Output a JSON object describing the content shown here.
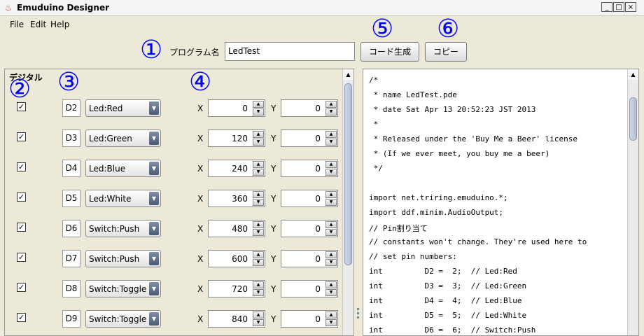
{
  "window": {
    "title": "Emuduino Designer"
  },
  "menu": [
    "File",
    "Edit",
    "Help"
  ],
  "callouts": [
    "①",
    "②",
    "③",
    "④",
    "⑤",
    "⑥"
  ],
  "toolbar": {
    "program_label": "プログラム名",
    "program_value": "LedTest",
    "generate_label": "コード生成",
    "copy_label": "コピー"
  },
  "digital": {
    "title": "デジタル",
    "rows": [
      {
        "pin": "D2",
        "type": "Led:Red",
        "x": "0",
        "y": "0"
      },
      {
        "pin": "D3",
        "type": "Led:Green",
        "x": "120",
        "y": "0"
      },
      {
        "pin": "D4",
        "type": "Led:Blue",
        "x": "240",
        "y": "0"
      },
      {
        "pin": "D5",
        "type": "Led:White",
        "x": "360",
        "y": "0"
      },
      {
        "pin": "D6",
        "type": "Switch:Push",
        "x": "480",
        "y": "0"
      },
      {
        "pin": "D7",
        "type": "Switch:Push",
        "x": "600",
        "y": "0"
      },
      {
        "pin": "D8",
        "type": "Switch:Toggle",
        "x": "720",
        "y": "0"
      },
      {
        "pin": "D9",
        "type": "Switch:Toggle",
        "x": "840",
        "y": "0"
      }
    ],
    "x_label": "X",
    "y_label": "Y"
  },
  "code_lines": [
    "/*",
    " * name LedTest.pde",
    " * date Sat Apr 13 20:52:23 JST 2013",
    " *",
    " * Released under the 'Buy Me a Beer' license",
    " * (If we ever meet, you buy me a beer)",
    " */",
    "",
    "import net.triring.emuduino.*;",
    "import ddf.minim.AudioOutput;",
    "// Pin割り当て",
    "// constants won't change. They're used here to",
    "// set pin numbers:",
    "int         D2 =  2;  // Led:Red",
    "int         D3 =  3;  // Led:Green",
    "int         D4 =  4;  // Led:Blue",
    "int         D5 =  5;  // Led:White",
    "int         D6 =  6;  // Switch:Push"
  ]
}
